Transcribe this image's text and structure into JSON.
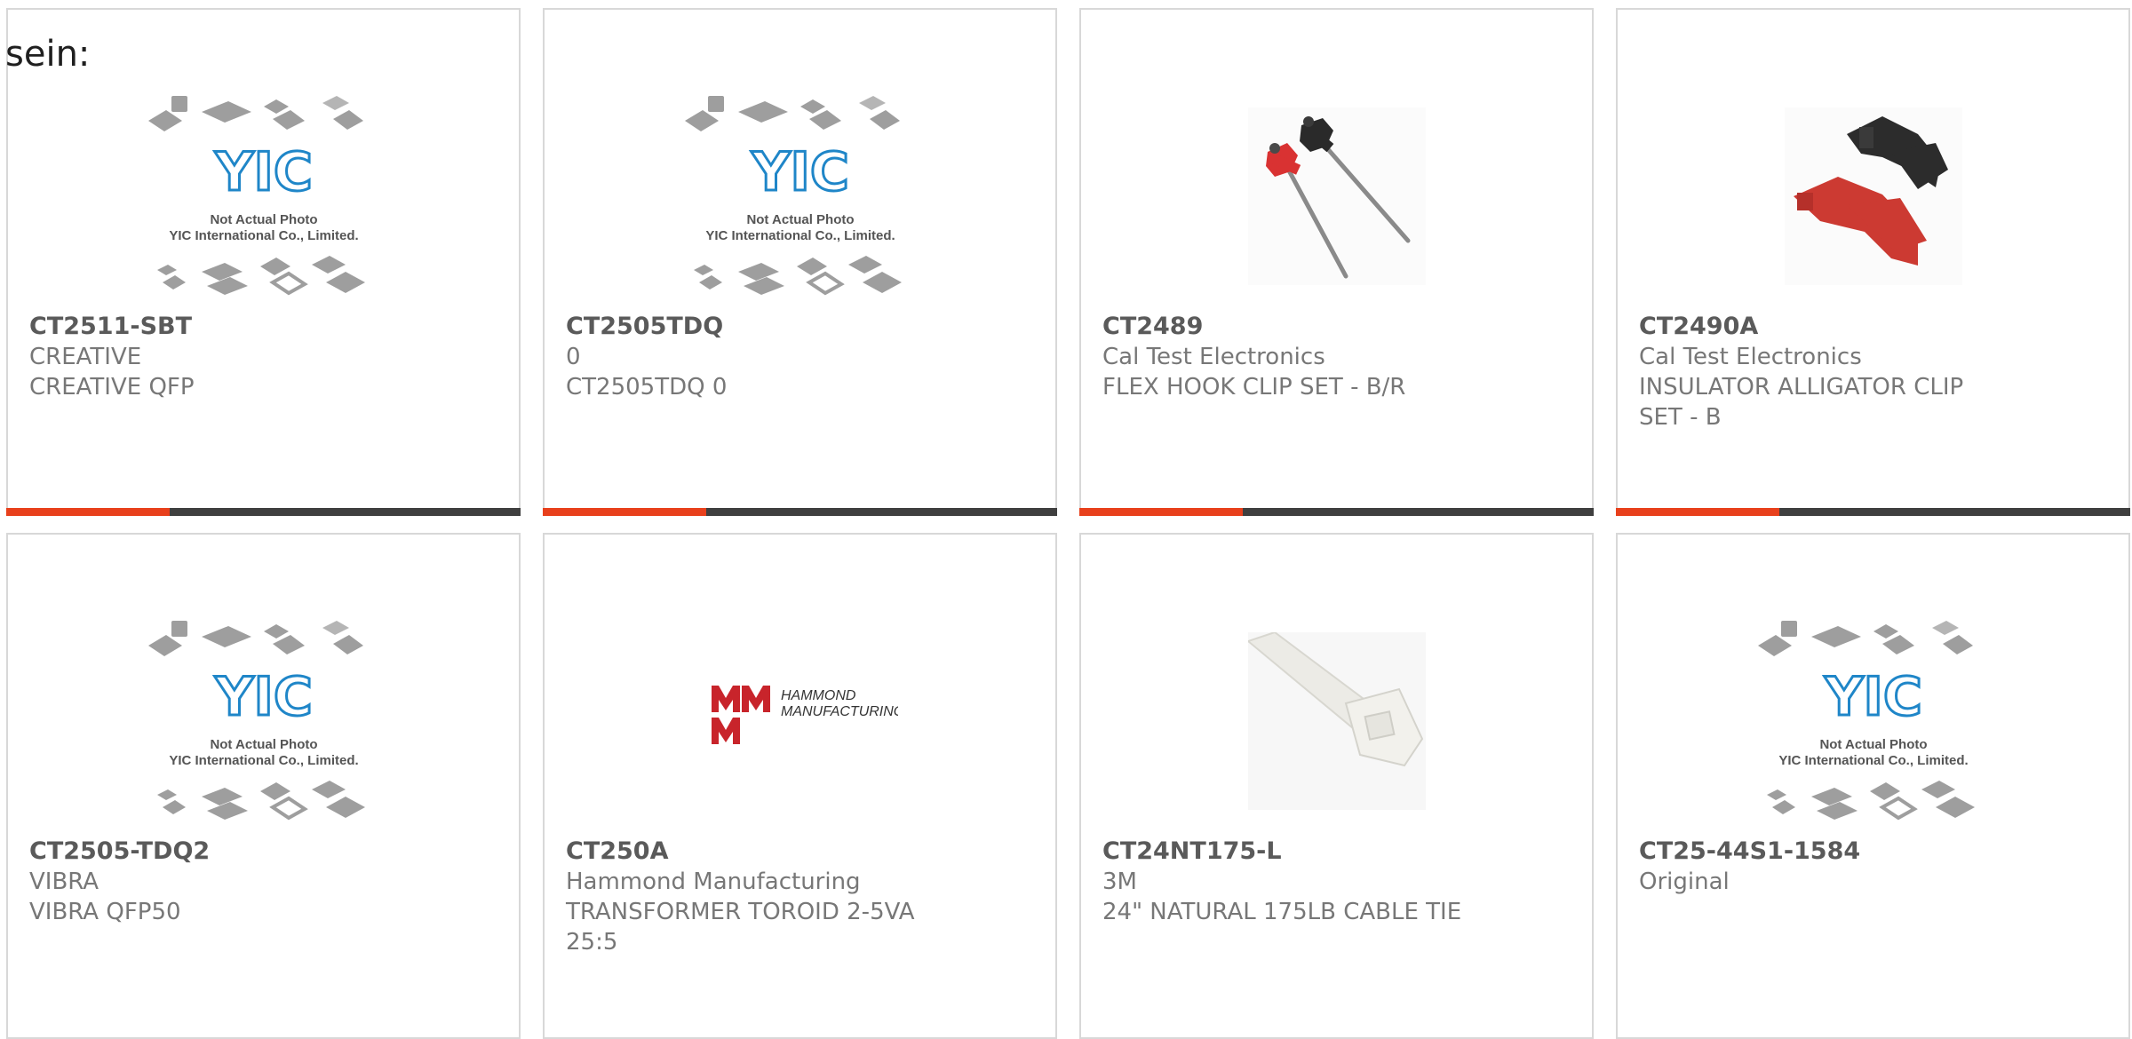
{
  "page": {
    "label": "sein:"
  },
  "placeholder": {
    "line1": "Not Actual Photo",
    "line2": "YIC International Co., Limited.",
    "logo": "YIC"
  },
  "hammond_logo": {
    "line1": "HAMMOND",
    "line2": "MANUFACTURING."
  },
  "products": [
    {
      "part": "CT2511-SBT",
      "maker": "CREATIVE",
      "desc": "CREATIVE QFP",
      "image": "yic-placeholder"
    },
    {
      "part": "CT2505TDQ",
      "maker": "0",
      "desc": "CT2505TDQ 0",
      "image": "yic-placeholder"
    },
    {
      "part": "CT2489",
      "maker": "Cal Test Electronics",
      "desc": "FLEX HOOK CLIP SET - B/R",
      "image": "hook-clips-photo"
    },
    {
      "part": "CT2490A",
      "maker": "Cal Test Electronics",
      "desc": "INSULATOR ALLIGATOR CLIP SET - B",
      "image": "alligator-clips-photo"
    },
    {
      "part": "CT2505-TDQ2",
      "maker": "VIBRA",
      "desc": "VIBRA QFP50",
      "image": "yic-placeholder"
    },
    {
      "part": "CT250A",
      "maker": "Hammond Manufacturing",
      "desc": "TRANSFORMER TOROID 2-5VA 25:5",
      "image": "hammond-logo"
    },
    {
      "part": "CT24NT175-L",
      "maker": "3M",
      "desc": "24\" NATURAL 175LB CABLE TIE",
      "image": "cable-tie-photo"
    },
    {
      "part": "CT25-44S1-1584",
      "maker": "Original",
      "desc": "",
      "image": "yic-placeholder"
    }
  ],
  "colors": {
    "accent": "#e8401c",
    "bar": "#3f3f3f",
    "yic_blue": "#1f86c8",
    "hammond_red": "#c8242b"
  }
}
